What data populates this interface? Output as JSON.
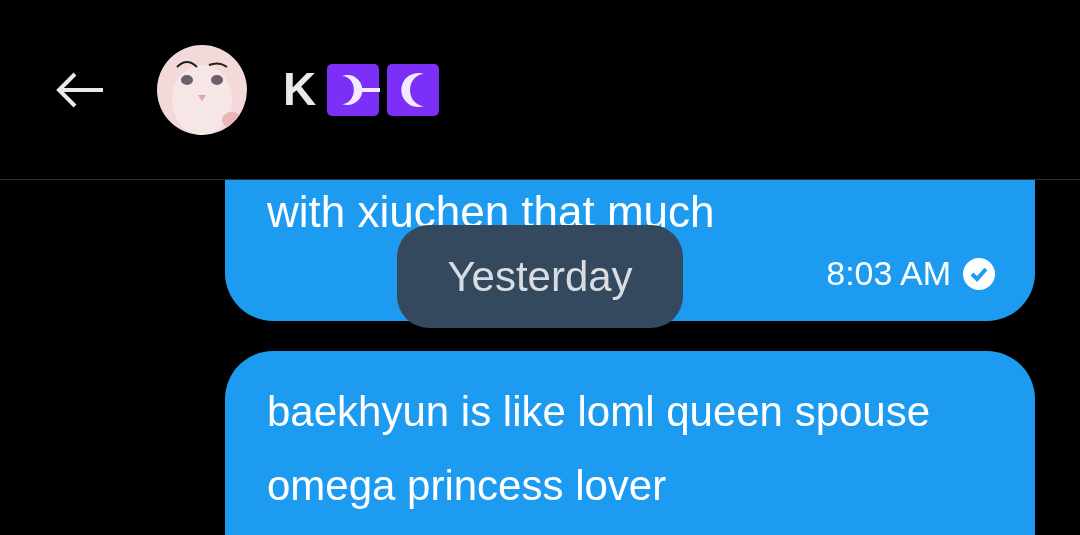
{
  "header": {
    "name": "K"
  },
  "messages": [
    {
      "text": "with xiuchen that much",
      "time": "8:03 AM"
    },
    {
      "text": "baekhyun is like loml queen spouse omega princess lover"
    }
  ],
  "date_separator": "Yesterday"
}
